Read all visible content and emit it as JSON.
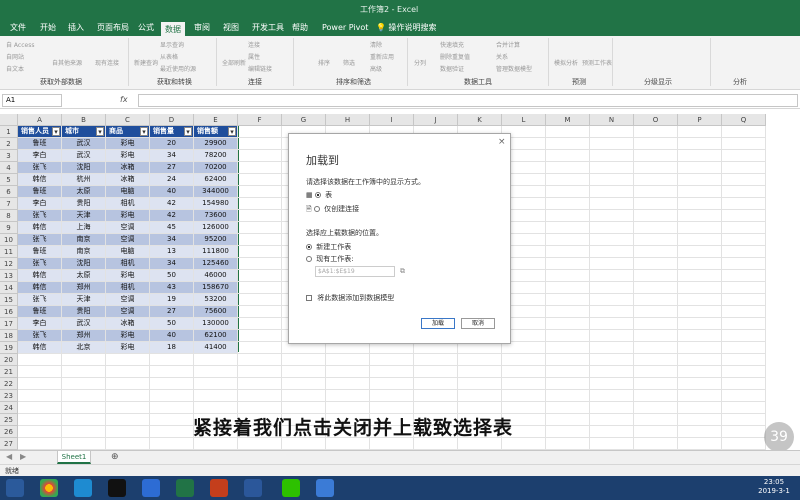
{
  "window": {
    "title": "工作簿2 - Excel"
  },
  "tabs": [
    "文件",
    "开始",
    "插入",
    "页面布局",
    "公式",
    "数据",
    "审阅",
    "视图",
    "开发工具",
    "帮助",
    "Power Pivot",
    "操作说明搜索"
  ],
  "active_tab": "数据",
  "ribbon": {
    "groups": [
      "获取外部数据",
      "获取和转换",
      "连接",
      "排序和筛选",
      "数据工具",
      "预测",
      "分级显示",
      "分析"
    ],
    "buttons": [
      "自 Access",
      "自网站",
      "自文本",
      "自其他来源",
      "现有连接",
      "新建查询",
      "显示查询",
      "从表格",
      "最近使用的源",
      "全部刷新",
      "连接",
      "属性",
      "编辑链接",
      "排序",
      "筛选",
      "清除",
      "重新应用",
      "高级",
      "分列",
      "快速填充",
      "删除重复值",
      "数据验证",
      "合并计算",
      "关系",
      "管理数据模型",
      "模拟分析",
      "预测工作表"
    ]
  },
  "formula_bar": {
    "name_box": "A1",
    "fx": "fx"
  },
  "columns": [
    "A",
    "B",
    "C",
    "D",
    "E",
    "F",
    "G",
    "H",
    "I",
    "J",
    "K",
    "L",
    "M",
    "N",
    "O",
    "P",
    "Q"
  ],
  "rows": [
    "1",
    "2",
    "3",
    "4",
    "5",
    "6",
    "7",
    "8",
    "9",
    "10",
    "11",
    "12",
    "13",
    "14",
    "15",
    "16",
    "17",
    "18",
    "19",
    "20",
    "21",
    "22",
    "23",
    "24",
    "25",
    "26",
    "27"
  ],
  "table": {
    "headers": [
      "销售人员",
      "城市",
      "商品",
      "销售量",
      "销售额"
    ],
    "data": [
      [
        "鲁班",
        "武汉",
        "彩电",
        "20",
        "29900"
      ],
      [
        "李白",
        "武汉",
        "彩电",
        "34",
        "78200"
      ],
      [
        "张飞",
        "沈阳",
        "冰箱",
        "27",
        "70200"
      ],
      [
        "韩信",
        "杭州",
        "冰箱",
        "24",
        "62400"
      ],
      [
        "鲁班",
        "太原",
        "电脑",
        "40",
        "344000"
      ],
      [
        "李白",
        "贵阳",
        "相机",
        "42",
        "154980"
      ],
      [
        "张飞",
        "天津",
        "彩电",
        "42",
        "73600"
      ],
      [
        "韩信",
        "上海",
        "空调",
        "45",
        "126000"
      ],
      [
        "张飞",
        "南京",
        "空调",
        "34",
        "95200"
      ],
      [
        "鲁班",
        "南京",
        "电脑",
        "13",
        "111800"
      ],
      [
        "张飞",
        "沈阳",
        "相机",
        "34",
        "125460"
      ],
      [
        "韩信",
        "太原",
        "彩电",
        "50",
        "46000"
      ],
      [
        "韩信",
        "郑州",
        "相机",
        "43",
        "158670"
      ],
      [
        "张飞",
        "天津",
        "空调",
        "19",
        "53200"
      ],
      [
        "鲁班",
        "贵阳",
        "空调",
        "27",
        "75600"
      ],
      [
        "李白",
        "武汉",
        "冰箱",
        "50",
        "130000"
      ],
      [
        "张飞",
        "郑州",
        "彩电",
        "40",
        "62100"
      ],
      [
        "韩信",
        "北京",
        "彩电",
        "18",
        "41400"
      ]
    ]
  },
  "dialog": {
    "title": "加载到",
    "close": "×",
    "prompt1": "请选择该数据在工作簿中的显示方式。",
    "opt_table": "表",
    "opt_connection": "仅创建连接",
    "prompt2": "选择应上载数据的位置。",
    "opt_new_sheet": "新建工作表",
    "opt_existing": "现有工作表:",
    "existing_ref": "$A$1:$E$19",
    "add_to_model": "将此数据添加到数据模型",
    "load_btn": "加载",
    "cancel_btn": "取消"
  },
  "caption": "紧接着我们点击关闭并上载致选择表",
  "badge": "39",
  "sheet_tab": "Sheet1",
  "add_sheet": "⊕",
  "status": "就绪",
  "clock": {
    "time": "23:05",
    "date": "2019-3-1"
  }
}
